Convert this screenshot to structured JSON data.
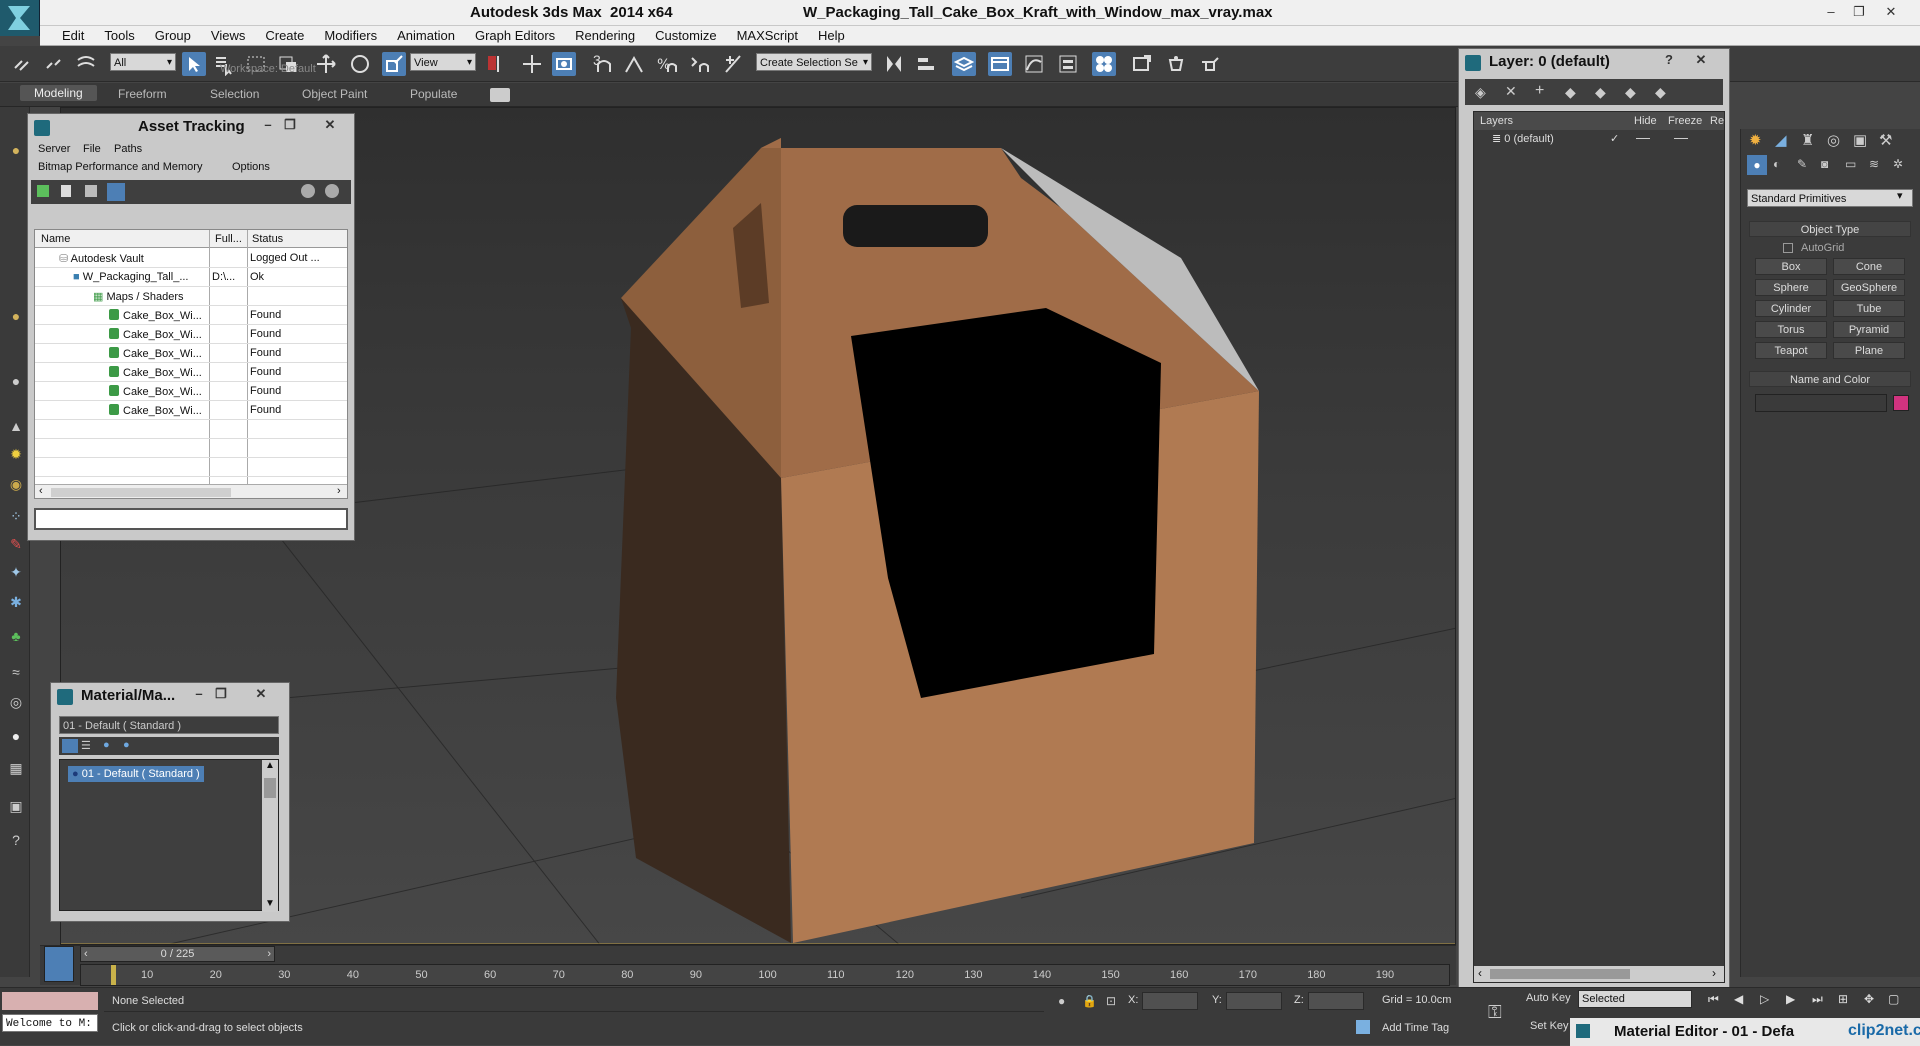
{
  "app": {
    "title": "Autodesk 3ds Max  2014 x64",
    "file": "W_Packaging_Tall_Cake_Box_Kraft_with_Window_max_vray.max",
    "window_controls": [
      "–",
      "❐",
      "✕"
    ]
  },
  "menu": [
    "Edit",
    "Tools",
    "Group",
    "Views",
    "Create",
    "Modifiers",
    "Animation",
    "Graph Editors",
    "Rendering",
    "Customize",
    "MAXScript",
    "Help"
  ],
  "toolbar": {
    "selection_filter": "All",
    "ref_coord": "View",
    "snap_value": "3",
    "selection_set_placeholder": "Create Selection Se"
  },
  "ribbon": {
    "tabs": [
      "Modeling",
      "Freeform",
      "Selection",
      "Object Paint",
      "Populate"
    ],
    "active": "Modeling",
    "workspace": "Workspace: Default"
  },
  "asset_tracking": {
    "title": "Asset Tracking",
    "menu": [
      "Server",
      "File",
      "Paths"
    ],
    "menu2": [
      "Bitmap Performance and Memory",
      "Options"
    ],
    "columns": [
      "Name",
      "Full...",
      "Status"
    ],
    "rows": [
      {
        "name": "Autodesk Vault",
        "full": "",
        "status": "Logged Out ..."
      },
      {
        "name": "W_Packaging_Tall_...",
        "full": "D:\\...",
        "status": "Ok"
      },
      {
        "name": "Maps / Shaders",
        "full": "",
        "status": ""
      },
      {
        "name": "Cake_Box_Wi...",
        "full": "",
        "status": "Found"
      },
      {
        "name": "Cake_Box_Wi...",
        "full": "",
        "status": "Found"
      },
      {
        "name": "Cake_Box_Wi...",
        "full": "",
        "status": "Found"
      },
      {
        "name": "Cake_Box_Wi...",
        "full": "",
        "status": "Found"
      },
      {
        "name": "Cake_Box_Wi...",
        "full": "",
        "status": "Found"
      },
      {
        "name": "Cake_Box_Wi...",
        "full": "",
        "status": "Found"
      }
    ]
  },
  "material_browser": {
    "title": "Material/Ma...",
    "current": "01 - Default  ( Standard )",
    "item": "01 - Default  ( Standard )"
  },
  "layer_panel": {
    "title": "Layer: 0 (default)",
    "help": "?",
    "columns": [
      "Layers",
      "Hide",
      "Freeze",
      "Re"
    ],
    "layer_name": "0 (default)",
    "check": "✓"
  },
  "command_panel": {
    "category": "Standard Primitives",
    "object_type_header": "Object Type",
    "autogrid": "AutoGrid",
    "buttons": [
      "Box",
      "Cone",
      "Sphere",
      "GeoSphere",
      "Cylinder",
      "Tube",
      "Torus",
      "Pyramid",
      "Teapot",
      "Plane"
    ],
    "name_color_header": "Name and Color",
    "color": "#d1337f"
  },
  "timeline": {
    "frame": "0 / 225",
    "ticks": [
      "10",
      "20",
      "30",
      "40",
      "50",
      "60",
      "70",
      "80",
      "90",
      "100",
      "110",
      "120",
      "130",
      "140",
      "150",
      "160",
      "170",
      "180",
      "190"
    ]
  },
  "status": {
    "maxscript": "Welcome to M:",
    "selection": "None Selected",
    "prompt": "Click or click-and-drag to select objects",
    "x_label": "X:",
    "y_label": "Y:",
    "z_label": "Z:",
    "grid": "Grid = 10.0cm",
    "auto_key": "Auto Key",
    "key_mode": "Selected",
    "set_key": "Set Key",
    "add_time_tag": "Add Time Tag",
    "material_editor_tab": "Material Editor - 01 - Defa",
    "watermark": "clip2net.com"
  },
  "colors": {
    "accent": "#4d7fb5",
    "box_kraft": "#b07a52",
    "viewport_bg": "#3b3b3b"
  }
}
